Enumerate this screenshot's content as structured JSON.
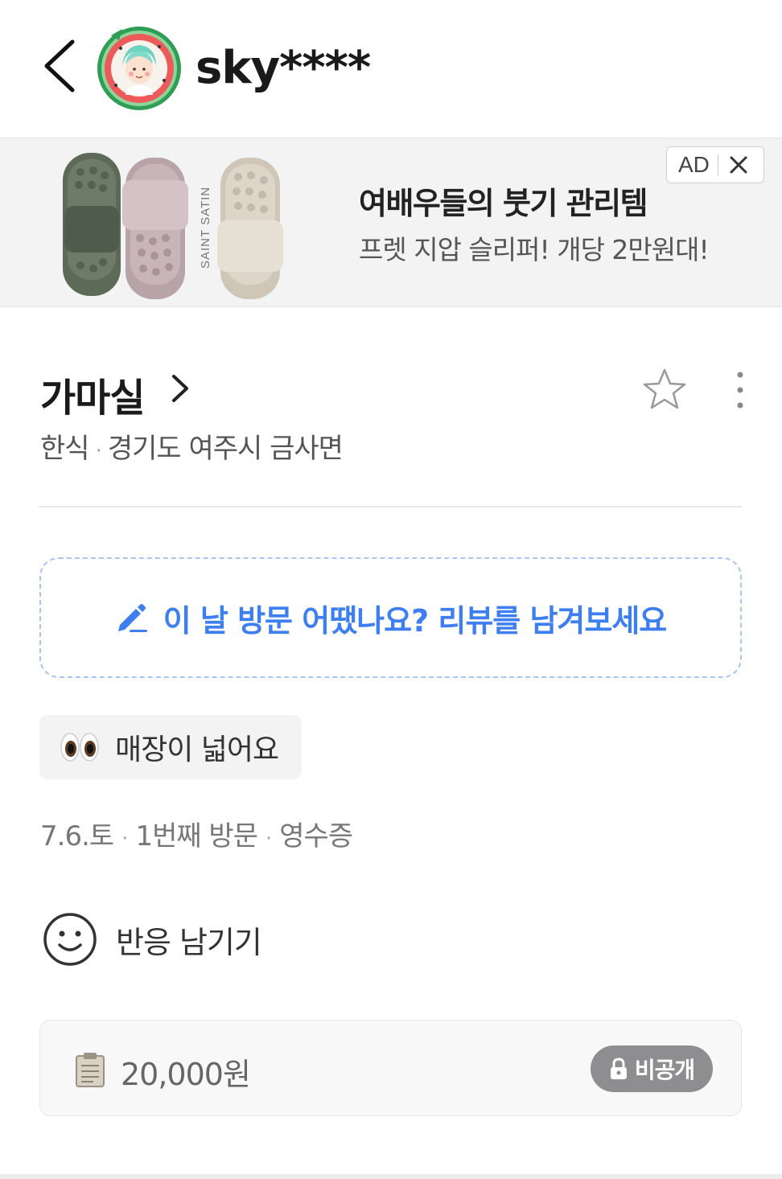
{
  "header": {
    "username": "sky****"
  },
  "ad": {
    "badge_label": "AD",
    "title": "여배우들의 붓기 관리템",
    "subtitle": "프렛 지압 슬리퍼! 개당 2만원대!",
    "brand_text": "SAINT SATIN"
  },
  "store": {
    "name": "가마실",
    "category": "한식",
    "location": "경기도 여주시 금사면"
  },
  "review_cta": {
    "label": "이 날 방문 어땠나요? 리뷰를 남겨보세요",
    "accent_color": "#3d7ef0"
  },
  "tag": {
    "emoji": "👀",
    "label": "매장이 넓어요"
  },
  "visit": {
    "date": "7.6.토",
    "count": "1번째 방문",
    "proof": "영수증"
  },
  "reaction": {
    "label": "반응 남기기"
  },
  "receipt": {
    "amount": "20,000원",
    "privacy_label": "비공개"
  }
}
